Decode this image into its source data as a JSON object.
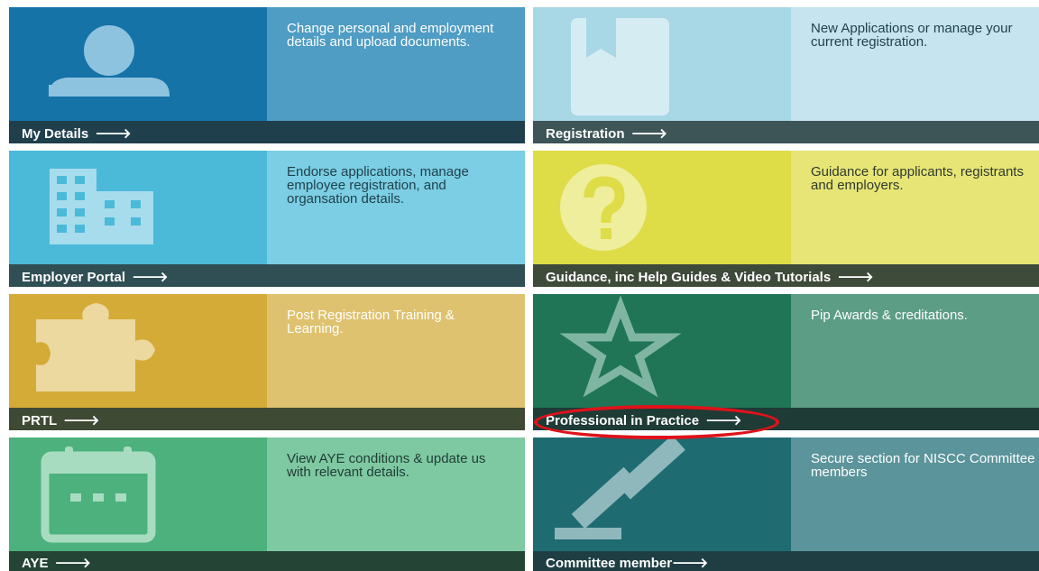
{
  "tiles": [
    {
      "id": "my-details",
      "label": "My Details",
      "arrow": "🡒",
      "description": "Change personal and employment details and upload documents.",
      "icon": "person-icon",
      "colors": {
        "icon_bg": "#1673a8",
        "desc_bg": "#4f9cc4",
        "bar_bg": "#1f3f4c"
      }
    },
    {
      "id": "registration",
      "label": "Registration",
      "arrow": "🡒",
      "description": "New Applications or manage your current registration.",
      "icon": "bookmark-icon",
      "colors": {
        "icon_bg": "#a8d7e6",
        "desc_bg": "#c5e4ef",
        "bar_bg": "#3e5558"
      }
    },
    {
      "id": "employer-portal",
      "label": "Employer Portal",
      "arrow": "🡒",
      "description": "Endorse applications, manage employee registration, and organsation details.",
      "icon": "building-icon",
      "colors": {
        "icon_bg": "#4bbad9",
        "desc_bg": "#7bcee3",
        "bar_bg": "#2f4f54"
      }
    },
    {
      "id": "guidance",
      "label": "Guidance, inc Help Guides & Video Tutorials",
      "arrow": "🡒",
      "description": "Guidance for applicants, registrants and employers.",
      "icon": "question-icon",
      "colors": {
        "icon_bg": "#dedc47",
        "desc_bg": "#e7e575",
        "bar_bg": "#3e4a3a"
      }
    },
    {
      "id": "prtl",
      "label": "PRTL",
      "arrow": "🡒",
      "description": "Post Registration Training & Learning.",
      "icon": "puzzle-icon",
      "colors": {
        "icon_bg": "#d5ab38",
        "desc_bg": "#dfc26f",
        "bar_bg": "#3f4a34"
      }
    },
    {
      "id": "professional-in-practice",
      "label": "Professional in Practice",
      "arrow": "🡒",
      "description": "Pip Awards & creditations.",
      "icon": "star-icon",
      "colors": {
        "icon_bg": "#1f7556",
        "desc_bg": "#5c9d86",
        "bar_bg": "#1f3b36"
      }
    },
    {
      "id": "aye",
      "label": "AYE",
      "arrow": "🡒",
      "description": "View AYE conditions & update us with relevant details.",
      "icon": "calendar-icon",
      "colors": {
        "icon_bg": "#4cb17d",
        "desc_bg": "#7ec9a2",
        "bar_bg": "#244436"
      }
    },
    {
      "id": "committee-member",
      "label": "Committee member",
      "arrow": "🡒",
      "description": "Secure section for NISCC Committee members",
      "icon": "gavel-icon",
      "colors": {
        "icon_bg": "#1f6b72",
        "desc_bg": "#5b949b",
        "bar_bg": "#1f3e44"
      }
    }
  ],
  "highlight": {
    "target": "professional-in-practice",
    "color": "#e0121a"
  }
}
